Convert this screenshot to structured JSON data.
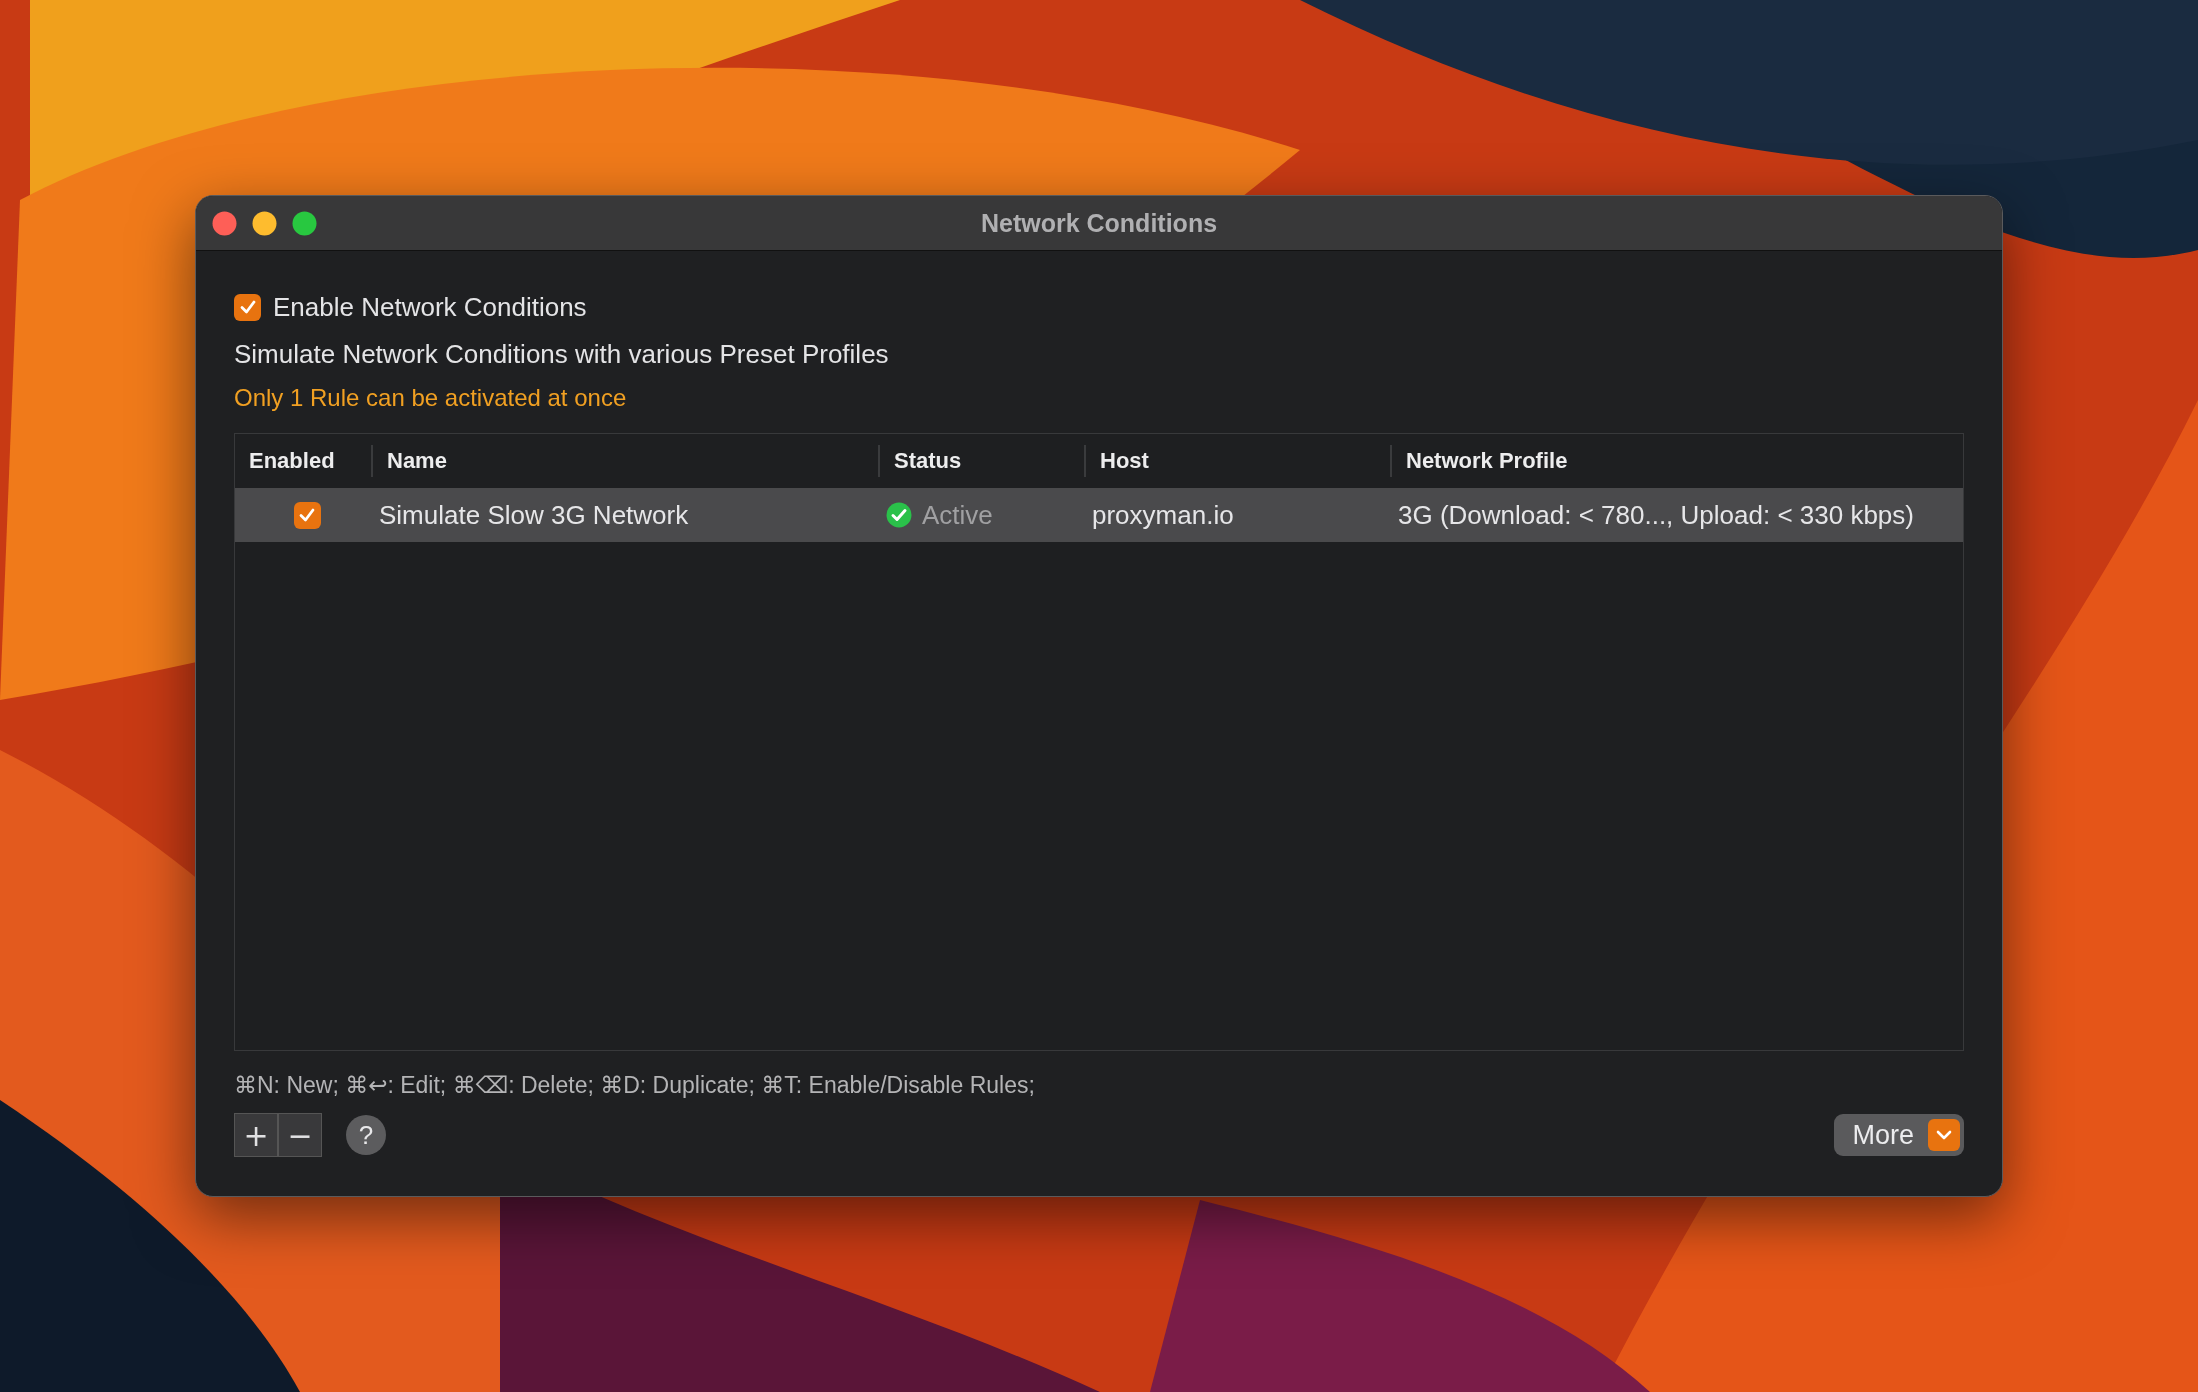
{
  "window": {
    "title": "Network Conditions"
  },
  "enable_checkbox": {
    "label": "Enable Network Conditions",
    "checked": true
  },
  "description": "Simulate Network Conditions with various Preset Profiles",
  "notice": "Only 1 Rule can be activated at once",
  "table": {
    "columns": [
      "Enabled",
      "Name",
      "Status",
      "Host",
      "Network Profile"
    ],
    "rows": [
      {
        "enabled": true,
        "selected": true,
        "name": "Simulate Slow 3G Network",
        "status": "Active",
        "active": true,
        "host": "proxyman.io",
        "network_profile": "3G (Download: < 780..., Upload: < 330 kbps)"
      }
    ]
  },
  "shortcuts_hint": "⌘N: New; ⌘↩: Edit; ⌘⌫: Delete; ⌘D: Duplicate; ⌘T: Enable/Disable Rules;",
  "footer": {
    "add_button": "+",
    "remove_button": "−",
    "help_button": "?",
    "more_button": "More"
  }
}
